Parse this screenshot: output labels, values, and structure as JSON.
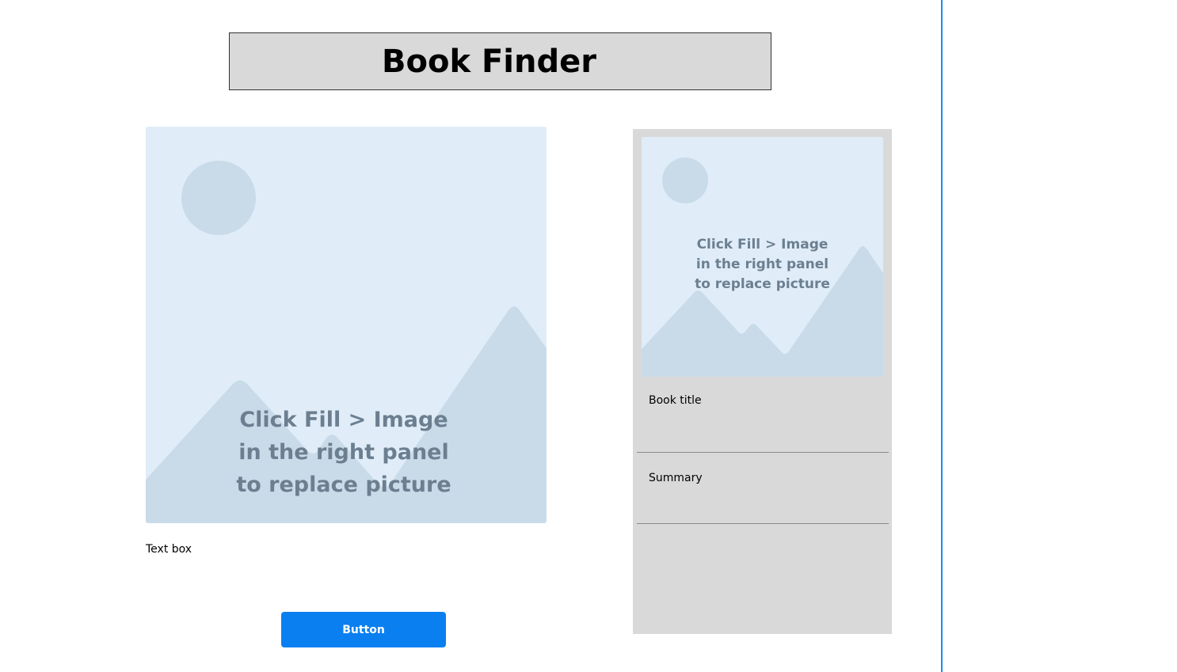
{
  "header": {
    "title": "Book Finder"
  },
  "main_image": {
    "placeholder_text": "Click Fill > Image\nin the right panel\nto replace picture",
    "line1": "Click Fill > Image",
    "line2": "in the right panel",
    "line3": "to replace picture",
    "icon": "image-placeholder-icon"
  },
  "text_box": {
    "label": "Text box"
  },
  "action_button": {
    "label": "Button"
  },
  "book_card": {
    "image": {
      "line1": "Click Fill > Image",
      "line2": "in the right panel",
      "line3": "to replace picture",
      "icon": "image-placeholder-icon"
    },
    "title_label": "Book title",
    "summary_label": "Summary"
  },
  "colors": {
    "accent": "#0a7ff0",
    "divider_line": "#1a8cf0",
    "panel_bg": "#d9d9d9",
    "placeholder_bg": "#e0edf8",
    "placeholder_shape": "#c9dbe9",
    "placeholder_text": "#6c7f90"
  }
}
